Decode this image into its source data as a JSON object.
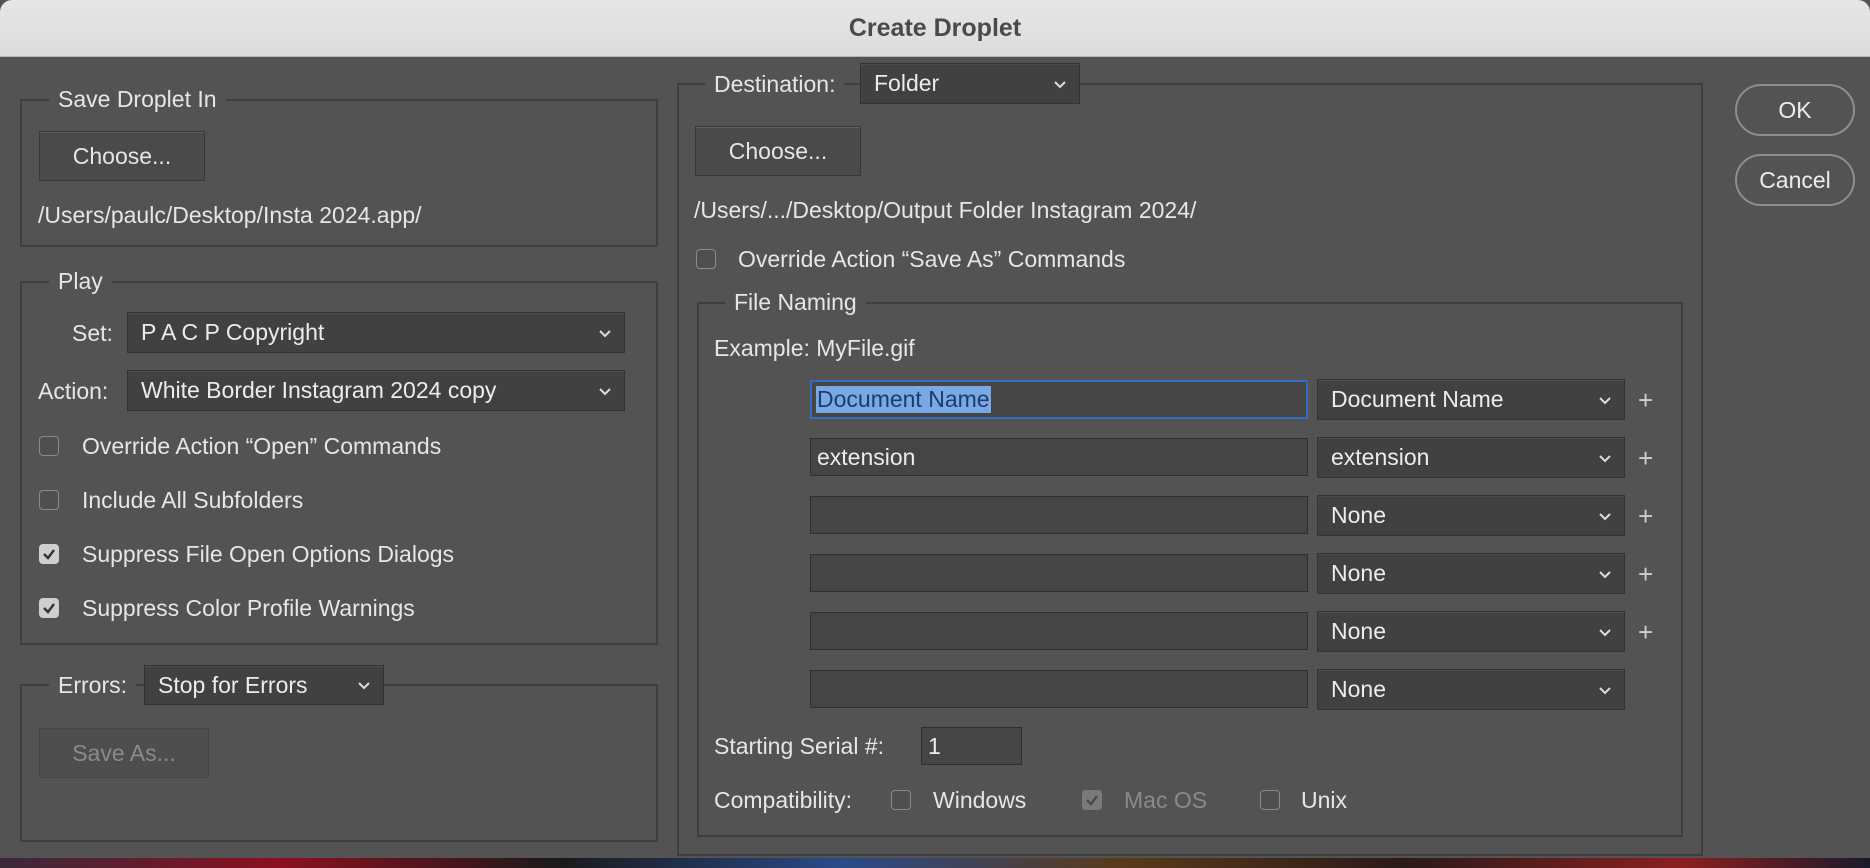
{
  "window": {
    "title": "Create Droplet"
  },
  "save_droplet": {
    "legend": "Save Droplet In",
    "choose_label": "Choose...",
    "path": "/Users/paulc/Desktop/Insta 2024.app/"
  },
  "play": {
    "legend": "Play",
    "set_label": "Set:",
    "set_value": "P A C P Copyright",
    "action_label": "Action:",
    "action_value": "White Border Instagram 2024 copy",
    "options": [
      {
        "label": "Override Action “Open” Commands",
        "checked": false
      },
      {
        "label": "Include All Subfolders",
        "checked": false
      },
      {
        "label": "Suppress File Open Options Dialogs",
        "checked": true
      },
      {
        "label": "Suppress Color Profile Warnings",
        "checked": true
      }
    ]
  },
  "errors": {
    "label": "Errors:",
    "value": "Stop for Errors",
    "save_as_label": "Save As..."
  },
  "destination": {
    "label": "Destination:",
    "value": "Folder",
    "choose_label": "Choose...",
    "path": "/Users/.../Desktop/Output Folder Instagram 2024/",
    "override_label": "Override Action “Save As” Commands",
    "override_checked": false
  },
  "file_naming": {
    "legend": "File Naming",
    "example": "Example: MyFile.gif",
    "rows": [
      {
        "field": "Document Name",
        "select": "Document Name",
        "plus": "+"
      },
      {
        "field": "extension",
        "select": "extension",
        "plus": "+"
      },
      {
        "field": "",
        "select": "None",
        "plus": "+"
      },
      {
        "field": "",
        "select": "None",
        "plus": "+"
      },
      {
        "field": "",
        "select": "None",
        "plus": "+"
      },
      {
        "field": "",
        "select": "None",
        "plus": ""
      }
    ],
    "serial_label": "Starting Serial #:",
    "serial_value": "1",
    "compat_label": "Compatibility:",
    "compat": [
      {
        "label": "Windows",
        "checked": false,
        "enabled": true
      },
      {
        "label": "Mac OS",
        "checked": true,
        "enabled": false
      },
      {
        "label": "Unix",
        "checked": false,
        "enabled": true
      }
    ]
  },
  "buttons": {
    "ok": "OK",
    "cancel": "Cancel"
  }
}
